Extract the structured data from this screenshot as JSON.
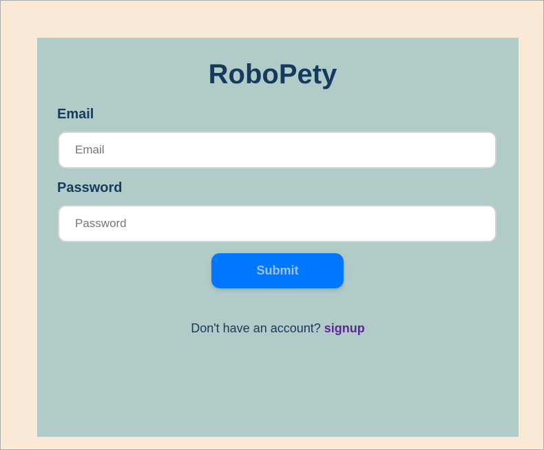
{
  "app": {
    "title": "RoboPety"
  },
  "form": {
    "email_label": "Email",
    "email_placeholder": "Email",
    "email_value": "",
    "password_label": "Password",
    "password_placeholder": "Password",
    "password_value": "",
    "submit_label": "Submit"
  },
  "footer": {
    "prompt": "Don't have an account?",
    "signup_link": "signup"
  },
  "colors": {
    "page_background": "#fae9d6",
    "card_background": "#b1cbc9",
    "text_primary": "#163a5c",
    "button_background": "#0077ff",
    "link": "#5a2a91"
  }
}
